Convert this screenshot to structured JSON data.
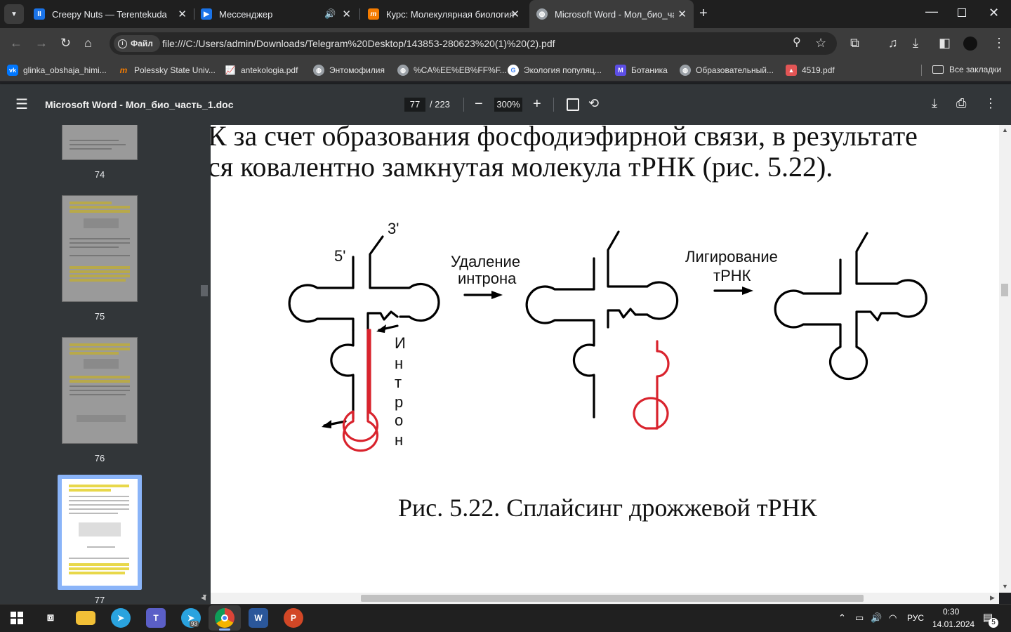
{
  "tabs": [
    {
      "title": "Creepy Nuts — Terentekuda",
      "icon": "pause-icon",
      "color": "#1a73e8"
    },
    {
      "title": "Мессенджер",
      "icon": "messenger-icon",
      "color": "#1a73e8"
    },
    {
      "title": "Курс: Молекулярная биология",
      "icon": "course-icon",
      "color": "#f57c00"
    },
    {
      "title": "Microsoft Word - Мол_био_час",
      "icon": "globe-icon",
      "color": "#9aa0a6"
    }
  ],
  "address": {
    "chip": "Файл",
    "url": "file:///C:/Users/admin/Downloads/Telegram%20Desktop/143853-280623%20(1)%20(2).pdf"
  },
  "bookmarks": [
    {
      "label": "glinka_obshaja_himi...",
      "icon": "vk-icon",
      "color": "#0077ff"
    },
    {
      "label": "Polessky State Univ...",
      "icon": "course-icon",
      "color": "#f57c00"
    },
    {
      "label": "antekologia.pdf",
      "icon": "chart-icon",
      "color": "#e25555"
    },
    {
      "label": "Энтомофилия",
      "icon": "globe-icon",
      "color": "#9aa0a6"
    },
    {
      "label": "%CA%EE%EB%FF%F...",
      "icon": "globe-icon",
      "color": "#9aa0a6"
    },
    {
      "label": "Экология популяц...",
      "icon": "google-icon",
      "color": "#ffffff"
    },
    {
      "label": "Ботаника",
      "icon": "m-icon",
      "color": "#5c4ee5"
    },
    {
      "label": "Образовательный...",
      "icon": "globe-icon",
      "color": "#9aa0a6"
    },
    {
      "label": "4519.pdf",
      "icon": "pdf-icon",
      "color": "#e25555"
    }
  ],
  "all_bookmarks": "Все закладки",
  "pdf": {
    "title": "Microsoft Word - Мол_био_часть_1.doc",
    "page": "77",
    "total": "/ 223",
    "zoom": "300%"
  },
  "thumbnails": [
    {
      "label": "74"
    },
    {
      "label": "75"
    },
    {
      "label": "76"
    },
    {
      "label": "77",
      "selected": true
    }
  ],
  "document": {
    "line1": "К за счет образования фосфодиэфирной связи, в результате",
    "line2": "ся ковалентно замкнутая молекула тРНК (рис. 5.22).",
    "caption": "Рис. 5.22. Сплайсинг дрожжевой тРНК"
  },
  "figure": {
    "label_3prime": "3'",
    "label_5prime": "5'",
    "step1_line1": "Удаление",
    "step1_line2": "интрона",
    "step2_line1": "Лигирование",
    "step2_line2": "тРНК",
    "intron_letters": [
      "И",
      "н",
      "т",
      "р",
      "о",
      "н"
    ],
    "intron_color": "#d9232d"
  },
  "taskbar": {
    "lang": "РУС",
    "time": "0:30",
    "date": "14.01.2024",
    "notifications": "5",
    "telegram_badge": "93"
  }
}
